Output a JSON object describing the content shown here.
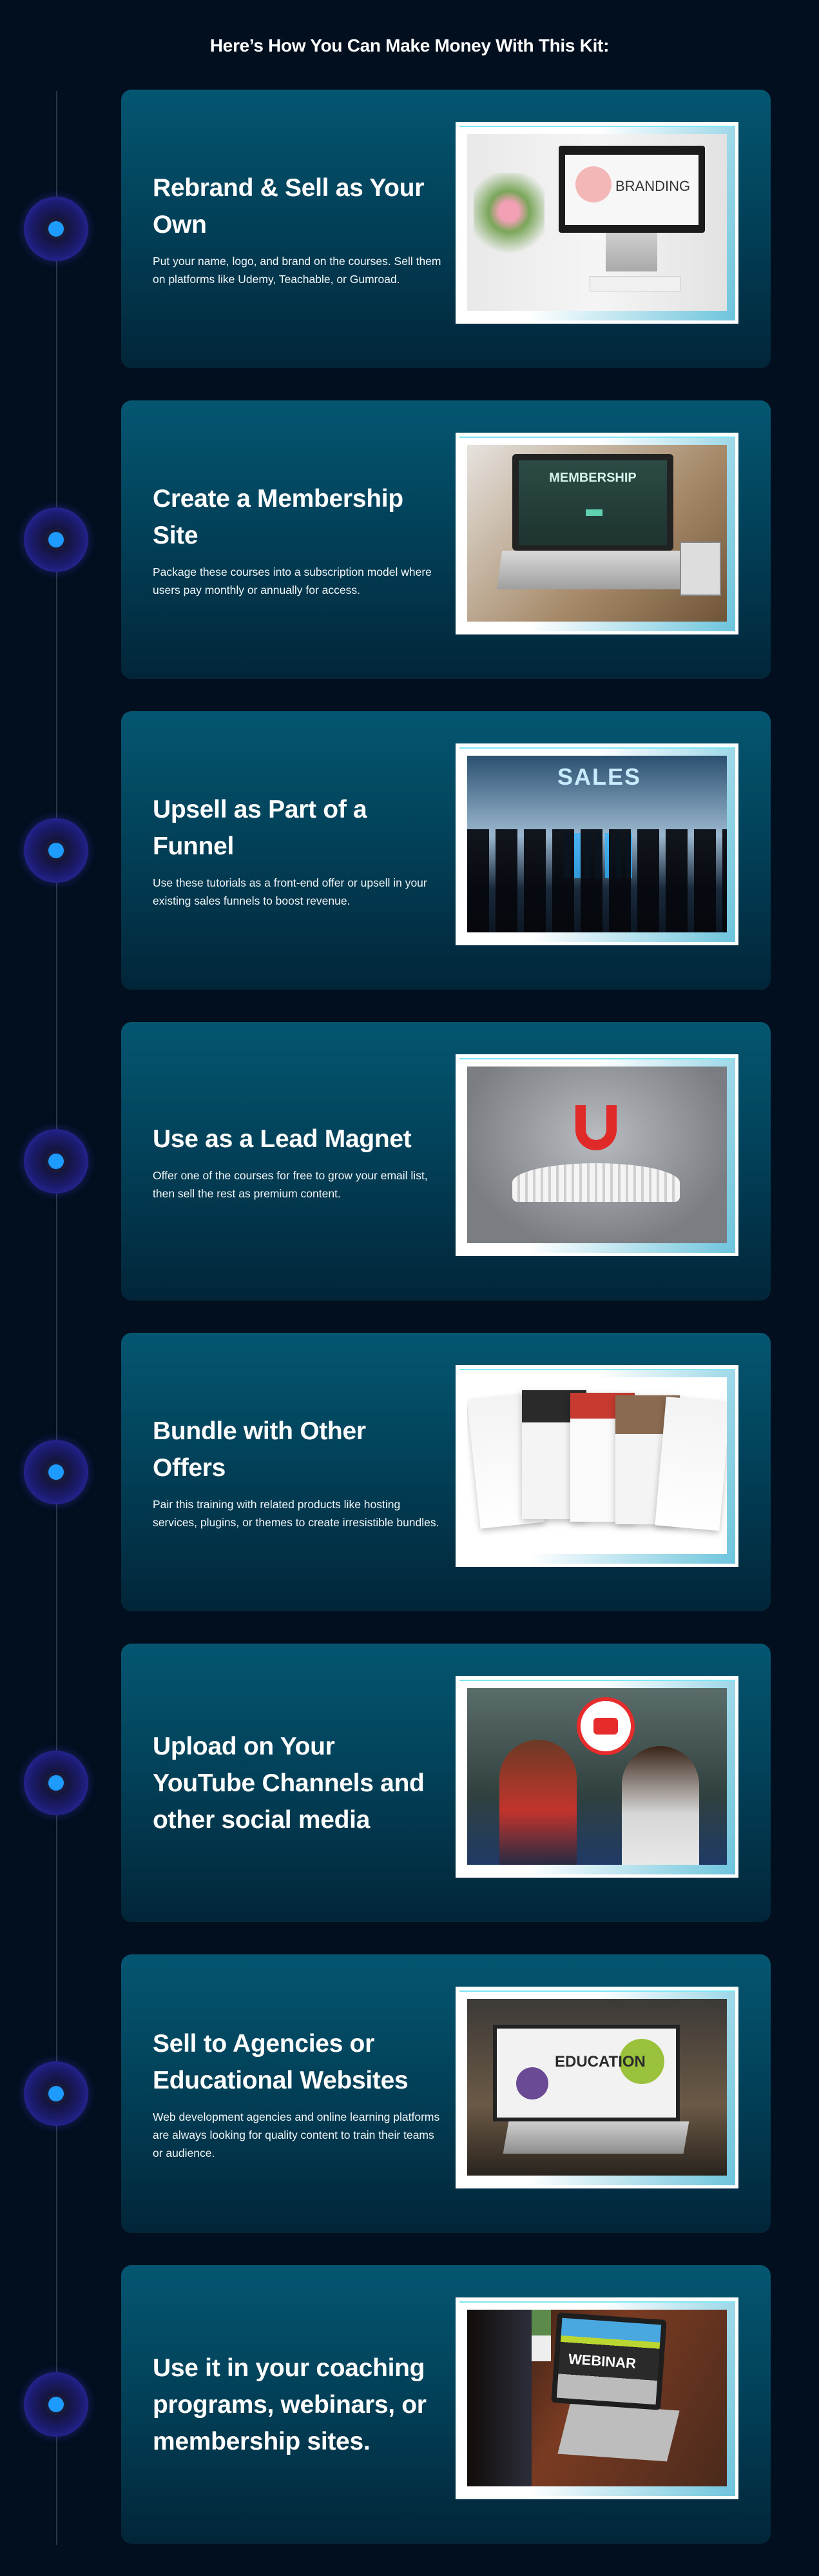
{
  "page": {
    "title": "Here’s How You Can Make Money With This Kit:"
  },
  "colors": {
    "background": "#020f1e",
    "card_top": "#045671",
    "card_bottom": "#022538",
    "timeline_dot": "#1e9bff",
    "timeline_glow": "#3431c4",
    "timeline_line": "#2b3645"
  },
  "cards": [
    {
      "heading": "Rebrand & Sell as Your Own",
      "description": "Put your name, logo, and brand on the courses. Sell them on platforms like Udemy, Teachable, or Gumroad.",
      "image_label": "BRANDING"
    },
    {
      "heading": "Create a Membership Site",
      "description": "Package these courses into a subscription model where users pay monthly or annually for access.",
      "image_label": "MEMBERSHIP"
    },
    {
      "heading": "Upsell as Part of a Funnel",
      "description": "Use these tutorials as a front-end offer or upsell in your existing sales funnels to boost revenue.",
      "image_label": "SALES"
    },
    {
      "heading": "Use as a Lead Magnet",
      "description": "Offer one of the courses for free to grow your email list, then sell the rest as premium content."
    },
    {
      "heading": "Bundle with Other Offers",
      "description": "Pair this training with related products like hosting services, plugins, or themes to create irresistible bundles."
    },
    {
      "heading": "Upload on Your YouTube Channels and other social media"
    },
    {
      "heading": "Sell to Agencies or Educational Websites",
      "description": "Web development agencies and online learning platforms are always looking for quality content to train their teams or audience.",
      "image_label": "EDUCATION"
    },
    {
      "heading": "Use it in your coaching programs, webinars, or membership sites.",
      "image_label": "WEBINAR"
    }
  ]
}
